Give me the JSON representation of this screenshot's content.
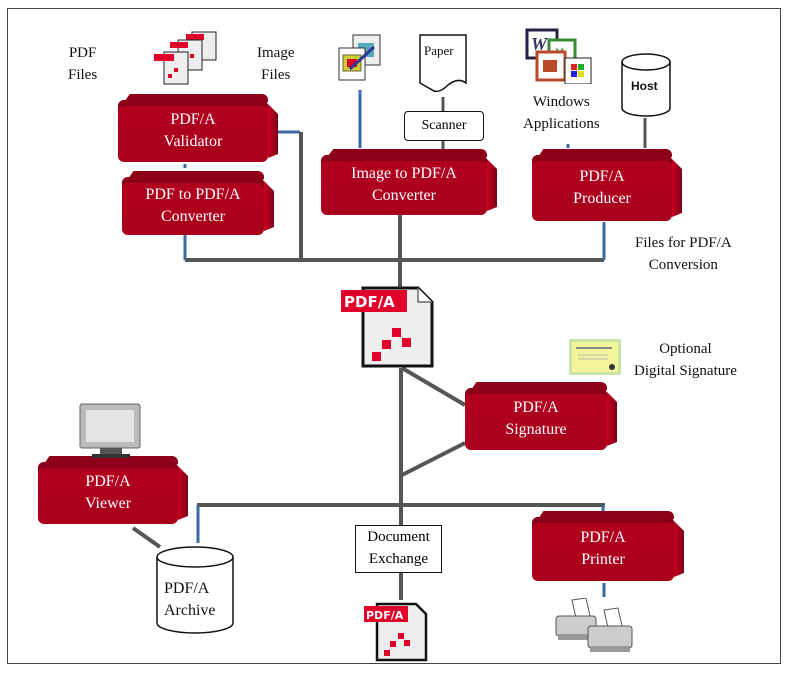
{
  "diagram": {
    "colors": {
      "component": "#ab001d",
      "connector": "#555555",
      "accent_line": "#3a6aa0"
    },
    "inputs": {
      "pdf_files": "PDF\nFiles",
      "image_files": "Image\nFiles",
      "paper": "Paper",
      "scanner": "Scanner",
      "windows_applications": "Windows\nApplications",
      "host": "Host",
      "files_for_conversion": "Files for PDF/A\nConversion",
      "optional_signature": "Optional\nDigital Signature"
    },
    "components": {
      "validator": [
        "PDF/A",
        "Validator"
      ],
      "pdf_converter": [
        "PDF to PDF/A",
        "Converter"
      ],
      "image_converter": [
        "Image to PDF/A",
        "Converter"
      ],
      "producer": [
        "PDF/A",
        "Producer"
      ],
      "signature": [
        "PDF/A",
        "Signature"
      ],
      "viewer": [
        "PDF/A",
        "Viewer"
      ],
      "printer": [
        "PDF/A",
        "Printer"
      ]
    },
    "outputs": {
      "archive": [
        "PDF/A",
        "Archive"
      ],
      "document_exchange": [
        "Document",
        "Exchange"
      ]
    },
    "pdfa_badge": "PDF/A",
    "icons": [
      "pdf-files-icon",
      "image-files-icon",
      "paper-icon",
      "office-apps-icon",
      "host-database-icon",
      "pdfa-document-icon",
      "certificate-icon",
      "monitor-icon",
      "archive-database-icon",
      "printer-icon"
    ]
  }
}
